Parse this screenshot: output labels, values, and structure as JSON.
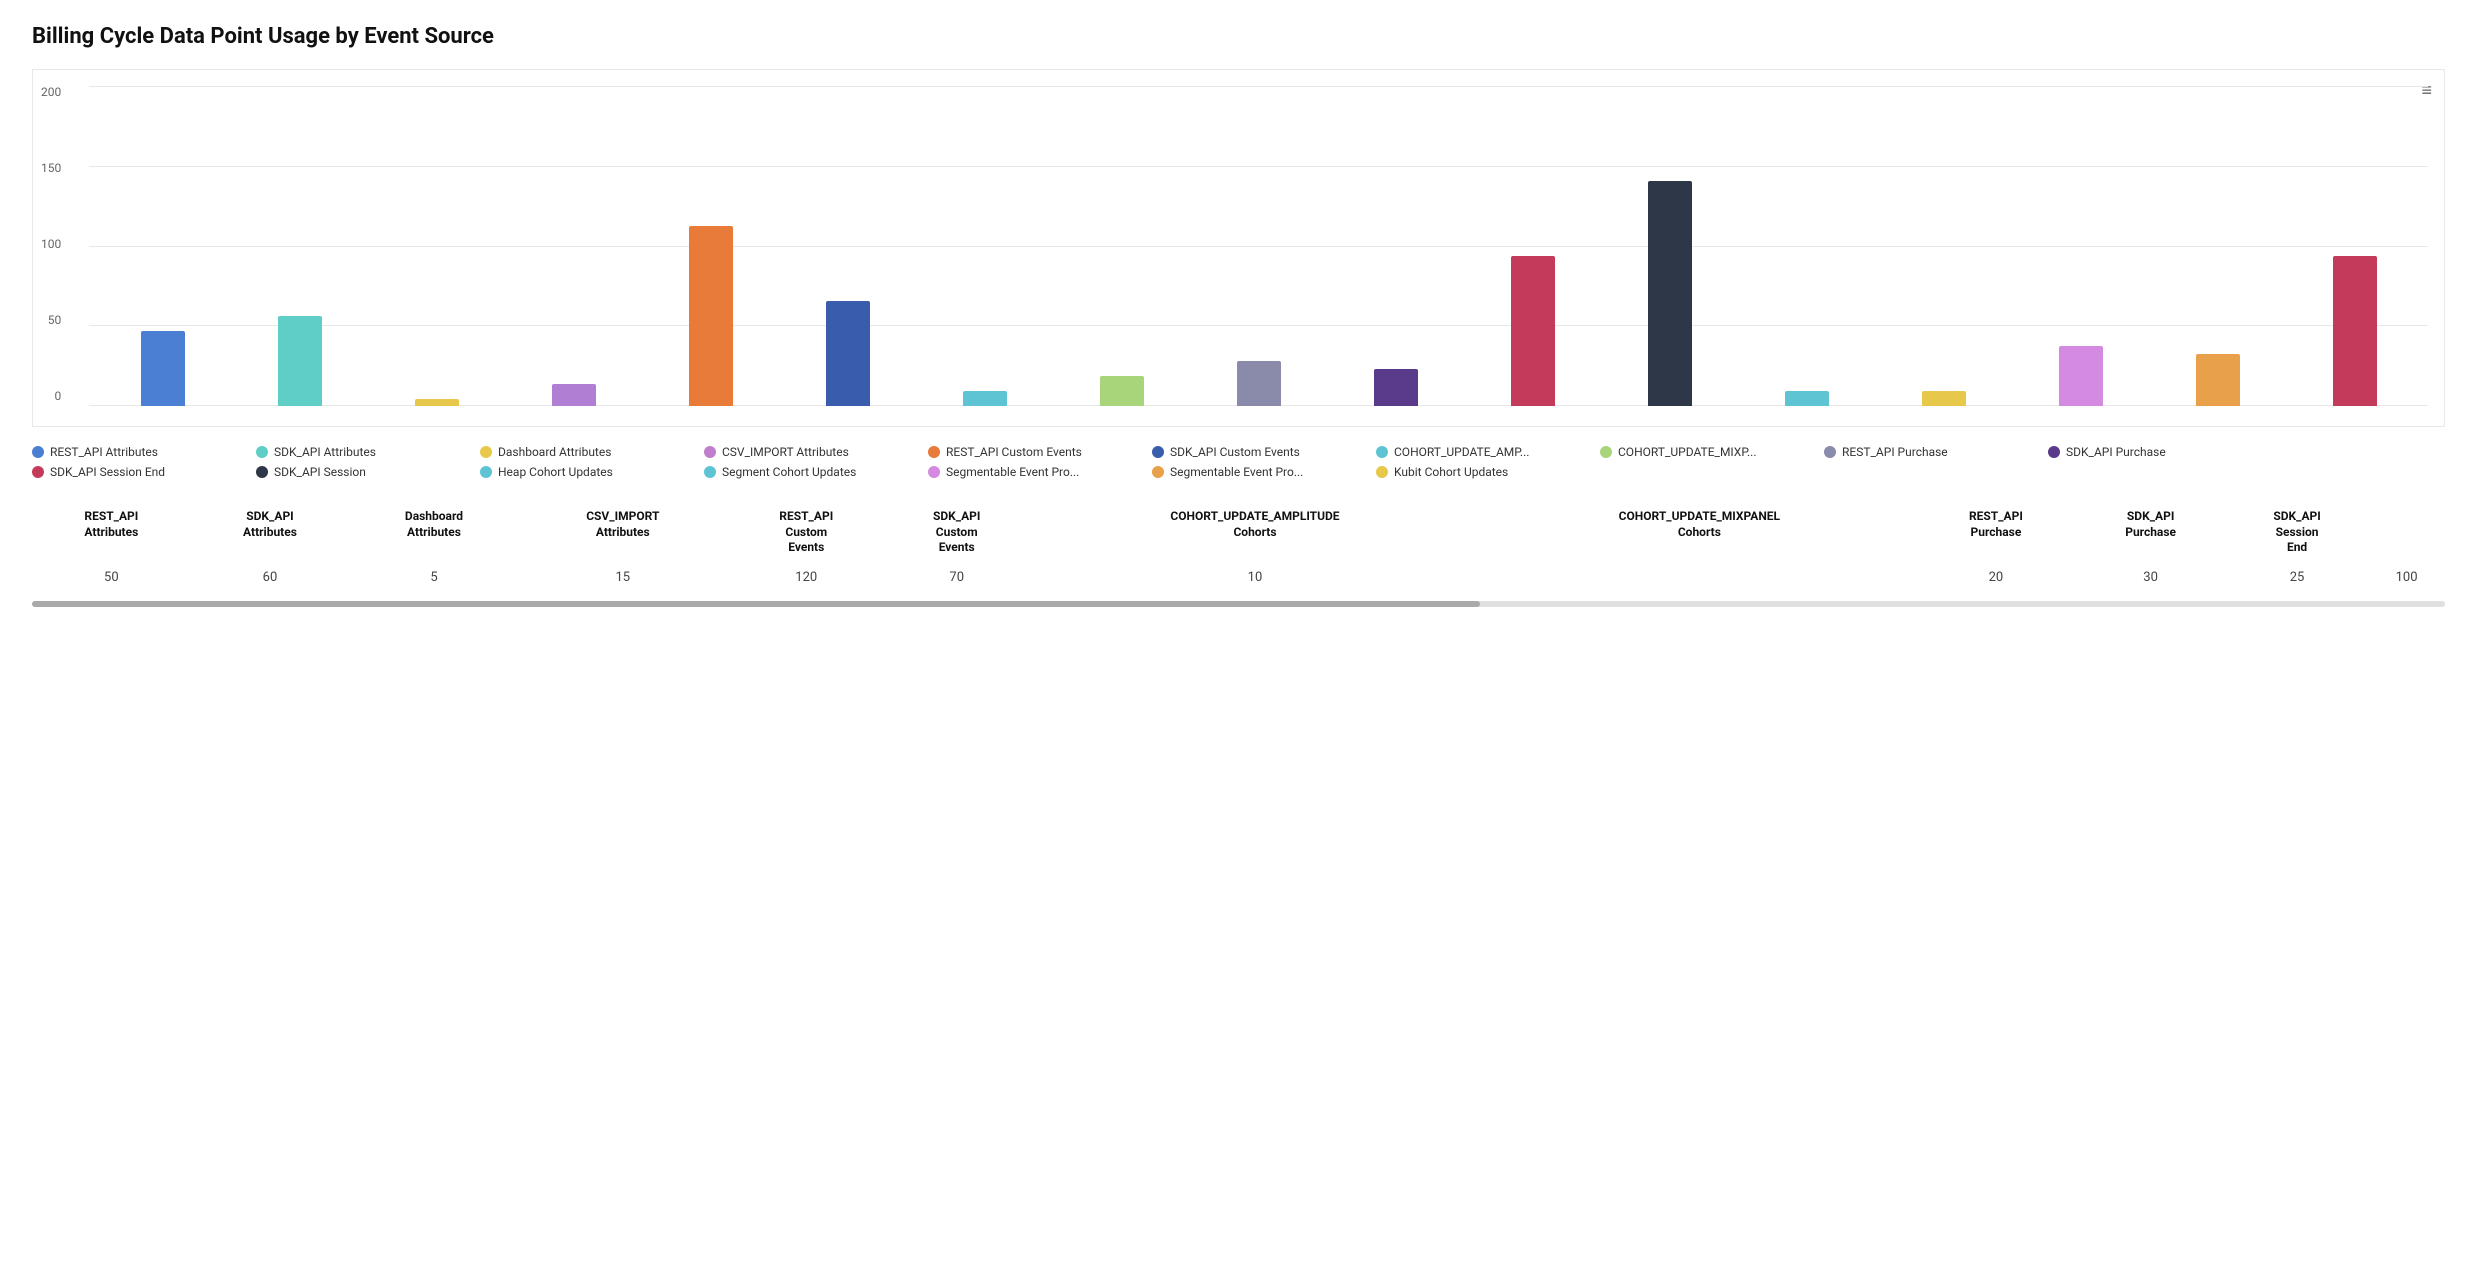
{
  "title": "Billing Cycle Data Point Usage by Event Source",
  "chart": {
    "yAxis": [
      0,
      50,
      100,
      150,
      200
    ],
    "menuIcon": "≡",
    "bars": [
      {
        "label": "REST_API Attributes",
        "value": 50,
        "color": "#4a7fd4",
        "height_pct": 25
      },
      {
        "label": "SDK_API Attributes",
        "value": 60,
        "color": "#5ecec6",
        "height_pct": 30
      },
      {
        "label": "Dashboard Attributes",
        "value": 5,
        "color": "#e8c84a",
        "height_pct": 2.5
      },
      {
        "label": "CSV_IMPORT Attributes",
        "value": 15,
        "color": "#b07fd4",
        "height_pct": 7.5
      },
      {
        "label": "REST_API Custom Events",
        "value": 120,
        "color": "#e87a3a",
        "height_pct": 60
      },
      {
        "label": "SDK_API Custom Events",
        "value": 70,
        "color": "#3a5cad",
        "height_pct": 35
      },
      {
        "label": "COHORT_UPDATE_AMP...",
        "value": 10,
        "color": "#5ec4d4",
        "height_pct": 5
      },
      {
        "label": "Heap Cohort Updates",
        "value": 20,
        "color": "#a8d47a",
        "height_pct": 10
      },
      {
        "label": "REST_API Purchase",
        "value": 30,
        "color": "#8a8aaa",
        "height_pct": 15
      },
      {
        "label": "SDK_API Purchase",
        "value": 25,
        "color": "#5a3a8a",
        "height_pct": 12.5
      },
      {
        "label": "COHORT_UPDATE_MIXP...",
        "value": 100,
        "color": "#c43a5a",
        "height_pct": 50
      },
      {
        "label": "SDK_API Session",
        "value": 150,
        "color": "#2d3748",
        "height_pct": 75
      },
      {
        "label": "Segment Cohort Updates",
        "value": 10,
        "color": "#5ec4d4",
        "height_pct": 5
      },
      {
        "label": "Kubit Cohort Updates",
        "value": 10,
        "color": "#e8c84a",
        "height_pct": 5
      },
      {
        "label": "Segmentable Event Pro...",
        "value": 40,
        "color": "#d48ae0",
        "height_pct": 20
      },
      {
        "label": "Segmentable Event Pro...",
        "value": 35,
        "color": "#e8a04a",
        "height_pct": 17.5
      },
      {
        "label": "SDK_API Session End",
        "value": 100,
        "color": "#c43a5a",
        "height_pct": 50
      }
    ]
  },
  "legend": {
    "items": [
      {
        "label": "REST_API Attributes",
        "color": "#4a7fd4"
      },
      {
        "label": "SDK_API Attributes",
        "color": "#5ecec6"
      },
      {
        "label": "Dashboard Attributes",
        "color": "#e8c84a"
      },
      {
        "label": "CSV_IMPORT Attributes",
        "color": "#c07fcc"
      },
      {
        "label": "REST_API Custom Events",
        "color": "#e87a3a"
      },
      {
        "label": "SDK_API Custom Events",
        "color": "#3a5cad"
      },
      {
        "label": "COHORT_UPDATE_AMP...",
        "color": "#5ec4d4"
      },
      {
        "label": "COHORT_UPDATE_MIXP...",
        "color": "#a8d47a"
      },
      {
        "label": "REST_API Purchase",
        "color": "#8a8aaa"
      },
      {
        "label": "SDK_API Purchase",
        "color": "#5a3a8a"
      },
      {
        "label": "SDK_API Session End",
        "color": "#c43a5a"
      },
      {
        "label": "SDK_API Session",
        "color": "#2d3748"
      },
      {
        "label": "Heap Cohort Updates",
        "color": "#5ec4d4"
      },
      {
        "label": "Segment Cohort Updates",
        "color": "#5ec4d4"
      },
      {
        "label": "Segmentable Event Pro...",
        "color": "#d48ae0"
      },
      {
        "label": "Segmentable Event Pro...",
        "color": "#e8a04a"
      },
      {
        "label": "Kubit Cohort Updates",
        "color": "#e8c84a"
      }
    ]
  },
  "bottomTable": {
    "columns": [
      {
        "header": "REST_API\nAttributes",
        "value": "50"
      },
      {
        "header": "SDK_API\nAttributes",
        "value": "60"
      },
      {
        "header": "Dashboard\nAttributes",
        "value": "5"
      },
      {
        "header": "CSV_IMPORT\nAttributes",
        "value": "15"
      },
      {
        "header": "REST_API\nCustom\nEvents",
        "value": "120"
      },
      {
        "header": "SDK_API\nCustom\nEvents",
        "value": "70"
      },
      {
        "header": "COHORT_UPDATE_AMPLITUDE\nCohorts",
        "value": "10"
      },
      {
        "header": "COHORT_UPDATE_MIXPANEL\nCohorts",
        "value": ""
      },
      {
        "header": "REST_API\nPurchase",
        "value": "20"
      },
      {
        "header": "SDK_API\nPurchase",
        "value": "30"
      },
      {
        "header": "SDK_API\nSession\nEnd",
        "value": "25"
      },
      {
        "header": "",
        "value": "100"
      }
    ]
  },
  "zeroLabel": "0"
}
